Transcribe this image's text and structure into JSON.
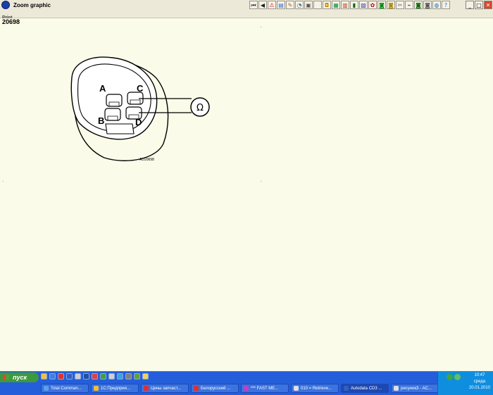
{
  "window": {
    "title": "Zoom graphic",
    "menu": [
      "Print"
    ],
    "toolbar_icons": [
      "first-page-icon",
      "prev-page-icon",
      "warning-icon",
      "book-icon",
      "wrench-icon",
      "gauge-icon",
      "camera-icon",
      "blank-icon",
      "car-icon",
      "grid-icon",
      "table-icon",
      "battery-icon",
      "chart-icon",
      "fan-icon",
      "car-icon",
      "car-icon",
      "tools-icon",
      "circuit-icon",
      "car-icon",
      "car-icon",
      "globe-icon",
      "help-icon"
    ],
    "controls": {
      "minimize": "_",
      "maximize": "□",
      "close": "✕"
    }
  },
  "content": {
    "figure_id": "20698",
    "diagram": {
      "pins": [
        "A",
        "B",
        "C",
        "D"
      ],
      "meter_symbol": "Ω",
      "code": "AD20698"
    }
  },
  "taskbar": {
    "start_label": "пуск",
    "tasks": [
      {
        "label": "Total Comman...",
        "color": "#5aa0f0"
      },
      {
        "label": "1С:Предприя...",
        "color": "#f0c030"
      },
      {
        "label": "Цены запчаст...",
        "color": "#e03030"
      },
      {
        "label": "Белорусский ...",
        "color": "#e03030"
      },
      {
        "label": "*** FAST ME...",
        "color": "#c040c0"
      },
      {
        "label": "010 = Retrieve...",
        "color": "#e0e0e0"
      },
      {
        "label": "Autodata CD3 ...",
        "color": "#3060c0"
      },
      {
        "label": "рисунок3 - AC...",
        "color": "#e0e0e0"
      }
    ],
    "clock": {
      "time": "10:47",
      "day": "среда",
      "date": "20.01.2010"
    }
  }
}
